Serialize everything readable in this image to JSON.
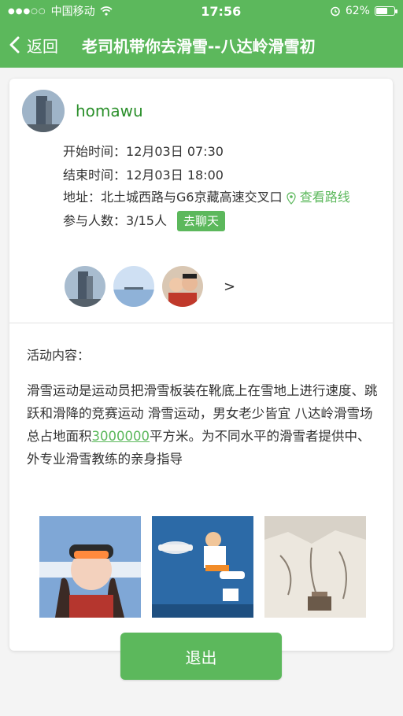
{
  "status_bar": {
    "carrier": "中国移动",
    "time": "17:56",
    "battery": "62%",
    "battery_level": 0.62
  },
  "nav": {
    "back_label": "返回",
    "title": "老司机带你去滑雪--八达岭滑雪初"
  },
  "host": {
    "name": "homawu"
  },
  "event": {
    "start_label": "开始时间：",
    "start_value": "12月03日 07:30",
    "end_label": "结束时间：",
    "end_value": "12月03日 18:00",
    "address_label": "地址：",
    "address_value": "北土城西路与G6京藏高速交叉口",
    "route_link": "查看路线",
    "participants_label": "参与人数：",
    "participants_value": "3/15人",
    "chat_button": "去聊天"
  },
  "content": {
    "label": "活动内容：",
    "text_part1": "滑雪运动是运动员把滑雪板装在靴底上在雪地上进行速度、跳跃和滑降的竞赛运动 滑雪运动，男女老少皆宜 八达岭滑雪场总占地面积",
    "text_link": "3000000",
    "text_part2": "平方米。为不同水平的滑雪者提供中、外专业滑雪教练的亲身指导"
  },
  "exit_button": "退出",
  "icons": {
    "back": "chevron-left-icon",
    "location": "map-pin-icon",
    "more": "chevron-right-icon",
    "alarm": "alarm-icon",
    "wifi": "wifi-icon",
    "battery": "battery-icon"
  },
  "colors": {
    "primary_green": "#5cb85c",
    "host_name_green": "#2a8f2a"
  }
}
